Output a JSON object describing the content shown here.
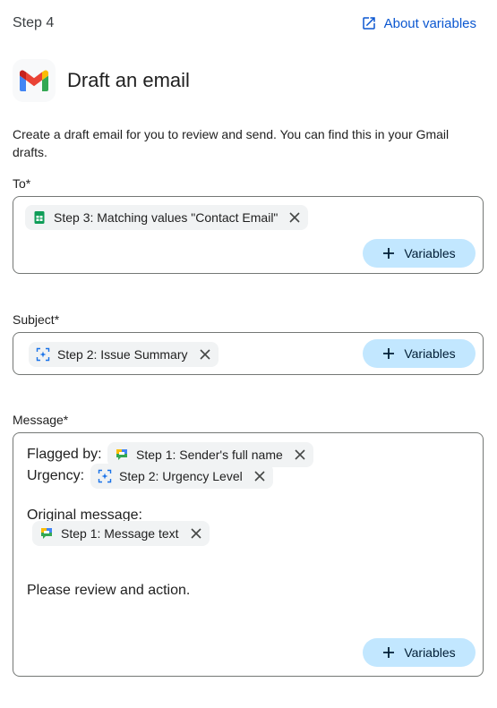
{
  "header": {
    "step": "Step 4",
    "about_link": "About variables"
  },
  "action": {
    "title": "Draft an email",
    "description": "Create a draft email for you to review and send. You can find this in your Gmail drafts."
  },
  "fields": {
    "to": {
      "label": "To*",
      "chips": [
        {
          "label": "Step 3: Matching values \"Contact Email\"",
          "icon": "sheets-icon"
        }
      ],
      "variables_button": "Variables"
    },
    "subject": {
      "label": "Subject*",
      "chips": [
        {
          "label": "Step 2: Issue Summary",
          "icon": "ai-sparkle-icon"
        }
      ],
      "variables_button": "Variables"
    },
    "message": {
      "label": "Message*",
      "flagged_by": "Flagged by:",
      "flagged_by_chip": "Step 1: Sender's full name",
      "urgency": "Urgency:",
      "urgency_chip": "Step 2: Urgency Level",
      "original_message": "Original message:",
      "original_chip": "Step 1: Message text",
      "closing": "Please review and action.",
      "variables_button": "Variables"
    }
  },
  "colors": {
    "accent": "#0b57d0",
    "button_bg": "#c2e7ff",
    "chip_bg": "#f1f3f4",
    "border": "#747775"
  }
}
